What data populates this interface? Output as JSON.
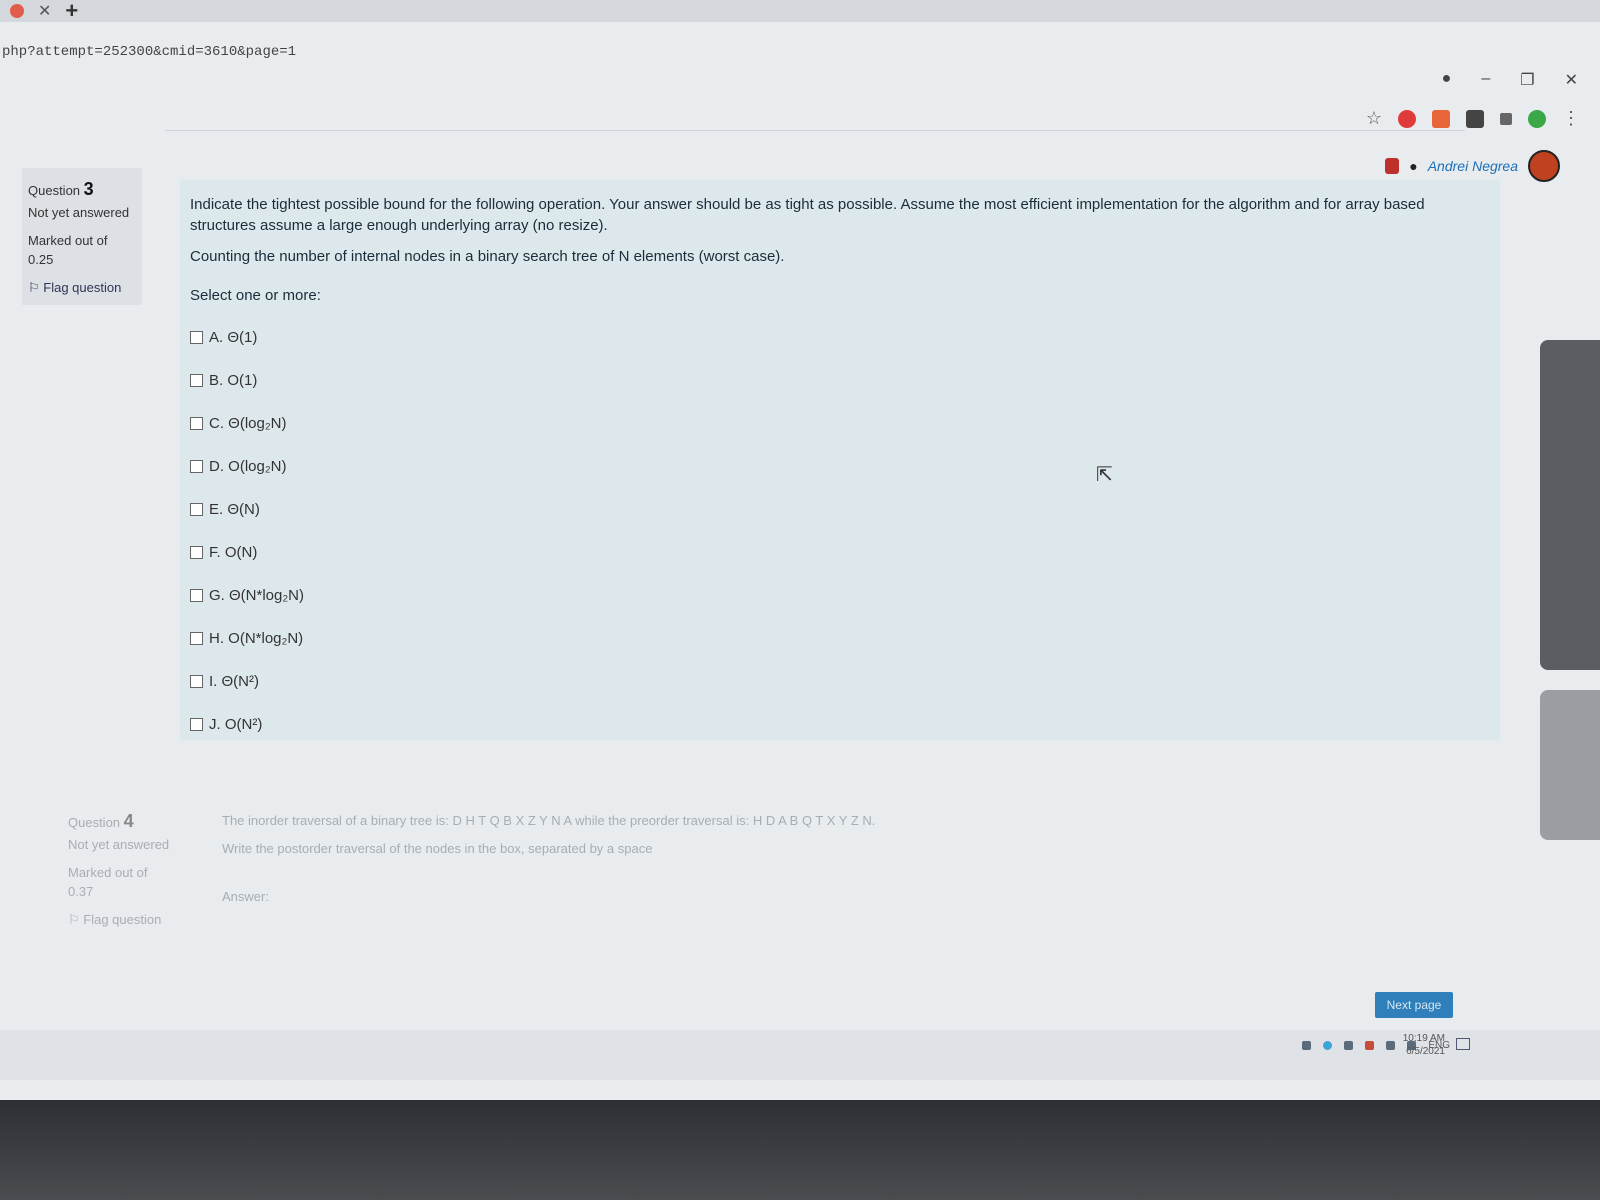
{
  "browser": {
    "url": "php?attempt=252300&cmid=3610&page=1",
    "user_name": "Andrei Negrea"
  },
  "question3": {
    "label": "Question",
    "number": "3",
    "status": "Not yet answered",
    "marked": "Marked out of 0.25",
    "flag": "Flag question",
    "text": "Indicate the tightest possible bound for the following operation. Your answer should be as tight as possible. Assume the most efficient implementation for the algorithm and for array based structures assume a large enough underlying array (no resize).",
    "operation": "Counting the number of internal nodes in a binary search tree of N elements (worst case).",
    "prompt": "Select one or more:",
    "options": [
      "A. Θ(1)",
      "B. O(1)",
      "C. Θ(log₂N)",
      "D. O(log₂N)",
      "E. Θ(N)",
      "F. O(N)",
      "G. Θ(N*log₂N)",
      "H. O(N*log₂N)",
      "I. Θ(N²)",
      "J. O(N²)"
    ]
  },
  "question4": {
    "label": "Question",
    "number": "4",
    "status": "Not yet answered",
    "marked": "Marked out of 0.37",
    "flag": "Flag question",
    "text": "The inorder traversal of a binary tree is: D H T Q B X Z Y N A while the preorder traversal is: H D A B Q T X Y Z N.",
    "instruction": "Write the postorder traversal of the nodes in the box, separated by a space",
    "answer_label": "Answer:"
  },
  "navigation": {
    "next_label": "Next page"
  },
  "taskbar": {
    "lang": "ENG",
    "time": "10:19 AM",
    "date": "6/5/2021"
  }
}
